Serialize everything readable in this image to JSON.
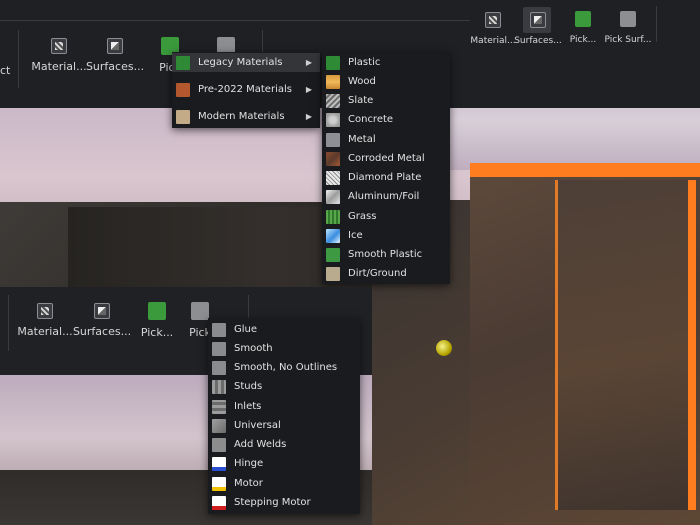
{
  "toolbar_top": {
    "partial_left_label": "ct",
    "items": [
      {
        "label": "Material...",
        "icon": "material-icon"
      },
      {
        "label": "Surfaces...",
        "icon": "surfaces-icon"
      },
      {
        "label": "Pick",
        "icon": "pick-material-icon"
      },
      {
        "label": "",
        "icon": "pick-surface-icon"
      }
    ]
  },
  "toolbar_top_right": {
    "items": [
      {
        "label": "Material...",
        "icon": "material-icon"
      },
      {
        "label": "Surfaces...",
        "icon": "surfaces-icon"
      },
      {
        "label": "Pick...",
        "icon": "pick-material-icon"
      },
      {
        "label": "Pick Surf...",
        "icon": "pick-surface-icon"
      }
    ]
  },
  "material_category_menu": {
    "items": [
      {
        "label": "Legacy Materials",
        "swatch": "legacy",
        "highlighted": true
      },
      {
        "label": "Pre-2022 Materials",
        "swatch": "pre-2022"
      },
      {
        "label": "Modern Materials",
        "swatch": "modern"
      }
    ]
  },
  "legacy_materials_menu": {
    "items": [
      {
        "label": "Plastic"
      },
      {
        "label": "Wood"
      },
      {
        "label": "Slate"
      },
      {
        "label": "Concrete"
      },
      {
        "label": "Metal"
      },
      {
        "label": "Corroded Metal"
      },
      {
        "label": "Diamond Plate"
      },
      {
        "label": "Aluminum/Foil"
      },
      {
        "label": "Grass"
      },
      {
        "label": "Ice"
      },
      {
        "label": "Smooth Plastic"
      },
      {
        "label": "Dirt/Ground"
      }
    ]
  },
  "toolbar_bottom": {
    "items": [
      {
        "label": "Material...",
        "icon": "material-icon"
      },
      {
        "label": "Surfaces...",
        "icon": "surfaces-icon"
      },
      {
        "label": "Pick...",
        "icon": "pick-material-icon"
      },
      {
        "label": "Pick",
        "icon": "pick-surface-icon"
      }
    ]
  },
  "surfaces_menu": {
    "items": [
      {
        "label": "Glue"
      },
      {
        "label": "Smooth"
      },
      {
        "label": "Smooth, No Outlines"
      },
      {
        "label": "Studs"
      },
      {
        "label": "Inlets"
      },
      {
        "label": "Universal"
      },
      {
        "label": "Add Welds"
      },
      {
        "label": "Hinge"
      },
      {
        "label": "Motor"
      },
      {
        "label": "Stepping Motor"
      }
    ]
  }
}
